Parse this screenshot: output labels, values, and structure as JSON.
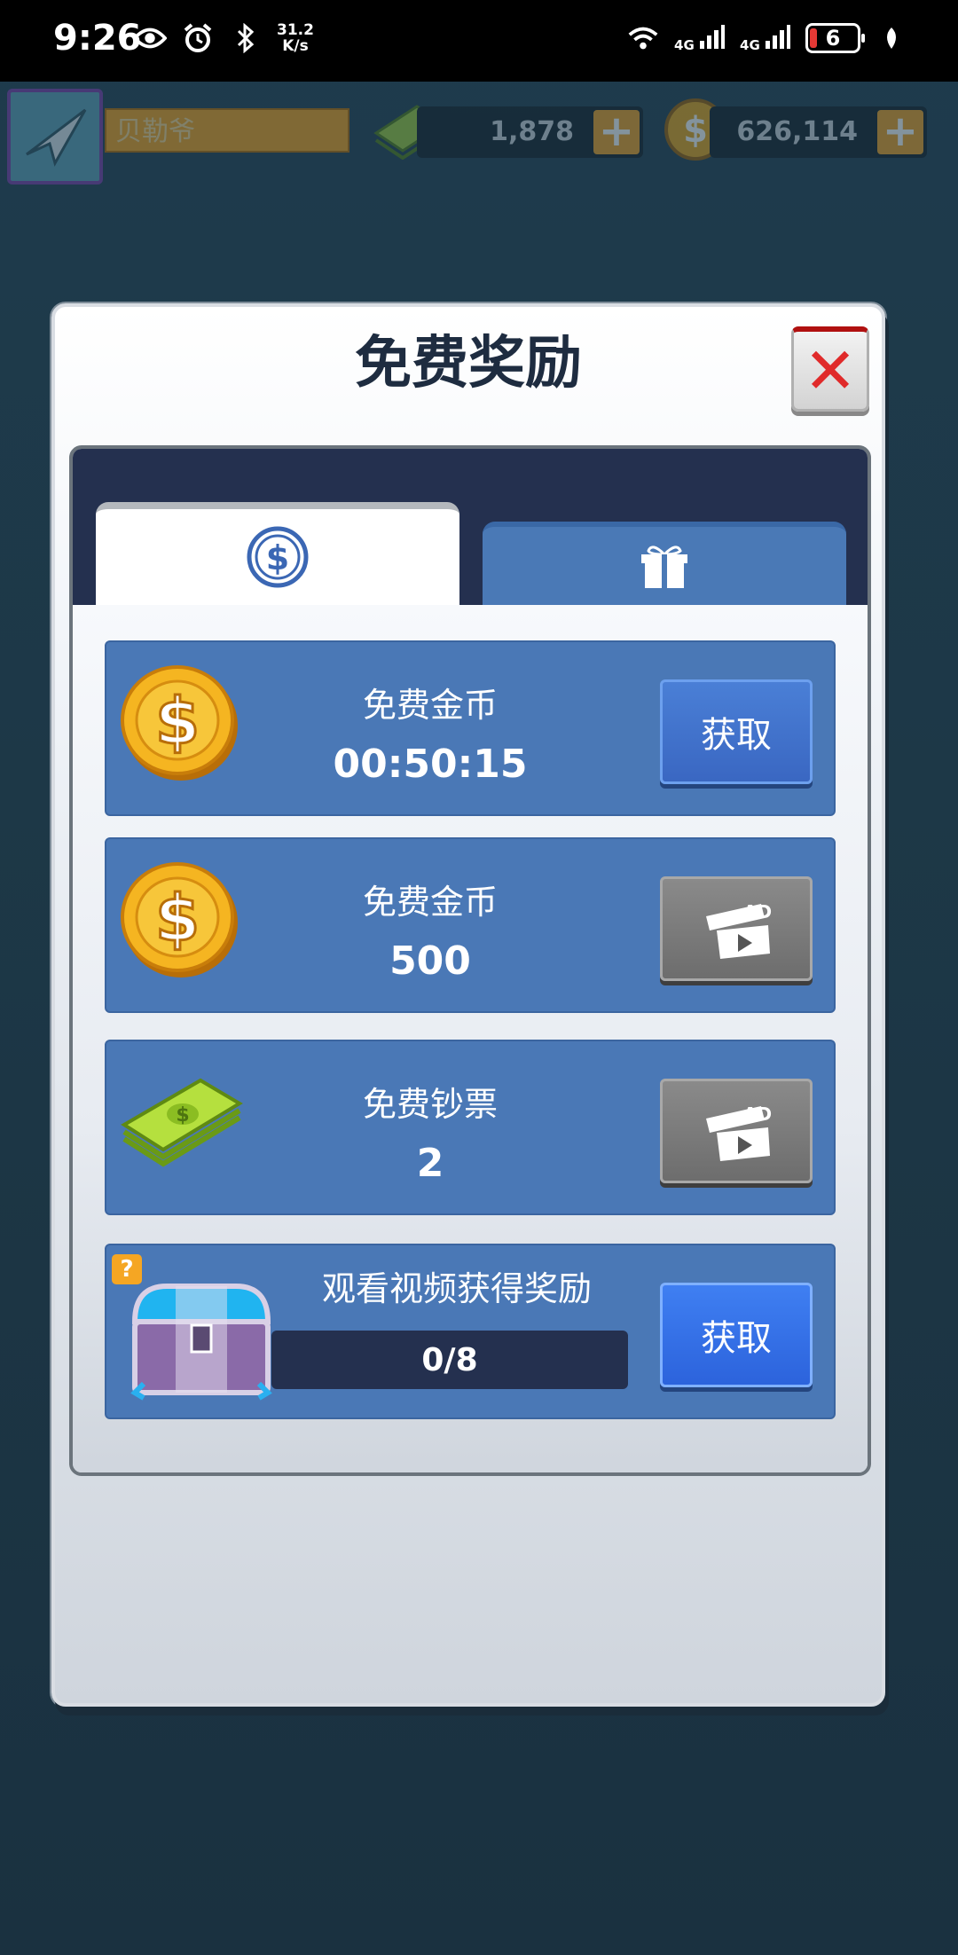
{
  "status_bar": {
    "time": "9:26",
    "speed_value": "31.2",
    "speed_unit": "K/s",
    "net1": "4G",
    "net2": "4G",
    "battery": "6"
  },
  "top_bar": {
    "player_name": "贝勒爷",
    "cash": "1,878",
    "coins": "626,114",
    "plus": "+"
  },
  "modal": {
    "title": "免费奖励",
    "close": "✕",
    "tabs": [
      {
        "icon": "dollar-icon",
        "active": true
      },
      {
        "icon": "gift-icon",
        "active": false
      }
    ],
    "cards": [
      {
        "title": "免费金币",
        "value": "00:50:15",
        "icon": "coin-icon",
        "button": "获取"
      },
      {
        "title": "免费金币",
        "value": "500",
        "icon": "coin-icon",
        "button_icon": "ad-video-icon",
        "ad": "AD"
      },
      {
        "title": "免费钞票",
        "value": "2",
        "icon": "cash-icon",
        "button_icon": "ad-video-icon",
        "ad": "AD"
      },
      {
        "title": "观看视频获得奖励",
        "progress": "0/8",
        "icon": "chest-icon",
        "button": "获取",
        "help": "?"
      }
    ]
  },
  "colors": {
    "card_blue": "#4a78b6",
    "panel_header": "#24304f",
    "coin_gold": "#f5b521",
    "cash_green": "#a6d63a"
  }
}
